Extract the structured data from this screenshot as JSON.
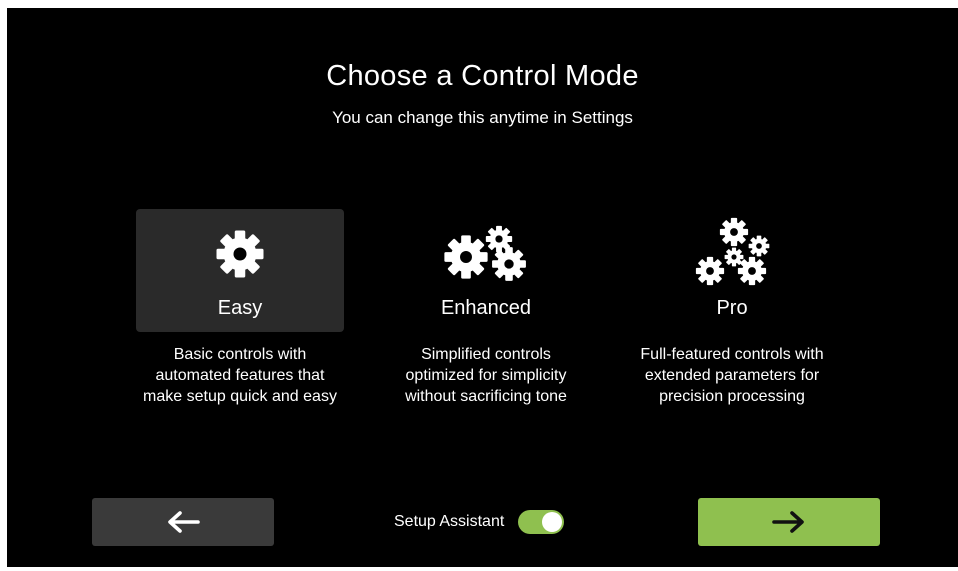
{
  "header": {
    "title": "Choose a Control Mode",
    "subtitle": "You can change this anytime in Settings"
  },
  "modes": [
    {
      "label": "Easy",
      "icon": "single-gear-icon",
      "description_lines": [
        "Basic controls with",
        "automated features that",
        "make setup quick and easy"
      ],
      "selected": true
    },
    {
      "label": "Enhanced",
      "icon": "two-gears-icon",
      "description_lines": [
        "Simplified controls",
        "optimized for simplicity",
        "without sacrificing tone"
      ],
      "selected": false
    },
    {
      "label": "Pro",
      "icon": "multi-gears-icon",
      "description_lines": [
        "Full-featured controls with",
        "extended parameters for",
        "precision processing"
      ],
      "selected": false
    }
  ],
  "footer": {
    "back_icon": "arrow-left-icon",
    "next_icon": "arrow-right-icon",
    "setup_assistant_label": "Setup Assistant",
    "setup_assistant_enabled": true
  },
  "colors": {
    "background": "#000000",
    "selected_card": "#2a2a2a",
    "back_button": "#3a3a3a",
    "accent": "#8fc04f",
    "text": "#ffffff"
  }
}
